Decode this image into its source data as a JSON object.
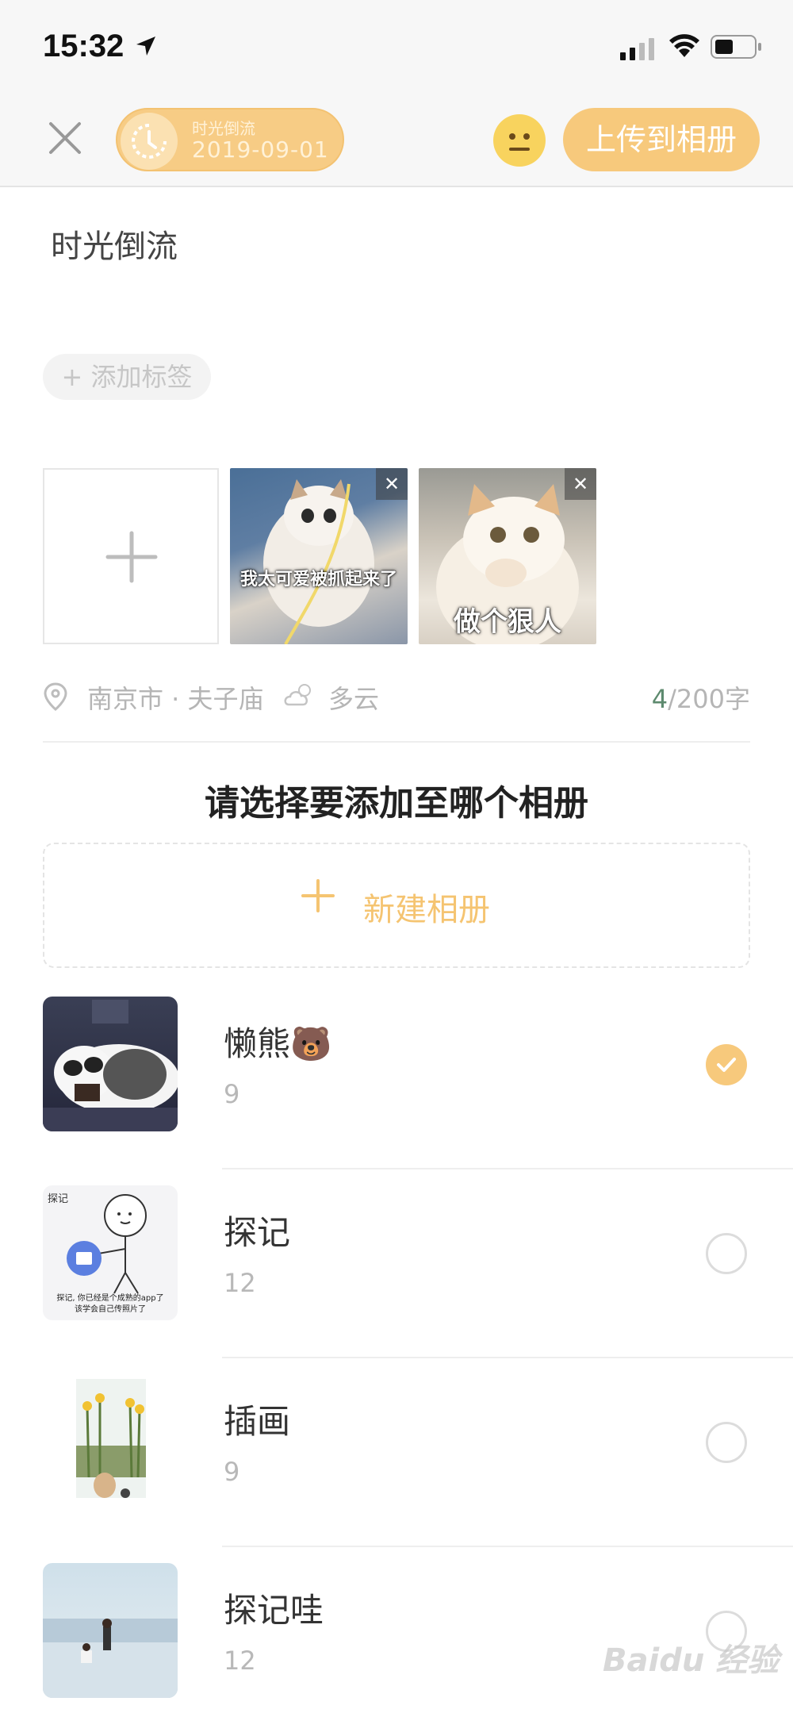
{
  "status_bar": {
    "time": "15:32"
  },
  "top_bar": {
    "time_back_title": "时光倒流",
    "time_back_date": "2019-09-01",
    "upload_label": "上传到相册"
  },
  "post": {
    "title": "时光倒流",
    "add_tag_label": "+ 添加标签",
    "photos": [
      {
        "caption": "我太可爱被抓起来了"
      },
      {
        "caption": "做个狠人"
      }
    ],
    "location": "南京市 · 夫子庙",
    "weather": "多云",
    "char_used": "4",
    "char_limit": "/200字"
  },
  "album_picker": {
    "title": "请选择要添加至哪个相册",
    "new_album_label": "新建相册",
    "albums": [
      {
        "name": "懒熊🐻",
        "count": "9",
        "selected": true
      },
      {
        "name": "探记",
        "count": "12",
        "selected": false
      },
      {
        "name": "插画",
        "count": "9",
        "selected": false
      },
      {
        "name": "探记哇",
        "count": "12",
        "selected": false
      }
    ],
    "thumb_texts": {
      "album_2_logo": "探记",
      "album_2_caption_1": "探记, 你已经是个成熟的app了",
      "album_2_caption_2": "该学会自己传照片了"
    }
  },
  "watermark": "Baidu 经验",
  "colors": {
    "accent": "#f7c97c",
    "accent_text": "#f5c471",
    "count_green": "#5d8a6e"
  }
}
